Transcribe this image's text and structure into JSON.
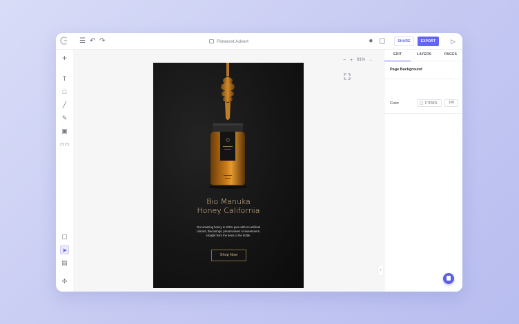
{
  "topbar": {
    "document_title": "Pinterest Advert",
    "share_label": "SHARE",
    "export_label": "EXPORT"
  },
  "canvas": {
    "zoom_level": "81%"
  },
  "right_panel": {
    "tabs": [
      {
        "label": "EDIT",
        "active": true
      },
      {
        "label": "LAYERS",
        "active": false
      },
      {
        "label": "PAGES",
        "active": false
      }
    ],
    "section_title": "Page Background",
    "color_label": "Color",
    "color_value": "F7F5F5",
    "opacity_value": "100"
  },
  "ad": {
    "headline_line1": "Bio Manuka",
    "headline_line2": "Honey California",
    "body_line1": "Our amazing honey is 100% pure with no artificial",
    "body_line2": "colours, flavourings, preservatives or sweeteners,",
    "body_line3": "straight from the bees to the bottle.",
    "cta_label": "Shop Now"
  },
  "colors": {
    "accent": "#6366f1",
    "artboard_bg": "#151515",
    "headline_gold": "#e3c79b"
  }
}
